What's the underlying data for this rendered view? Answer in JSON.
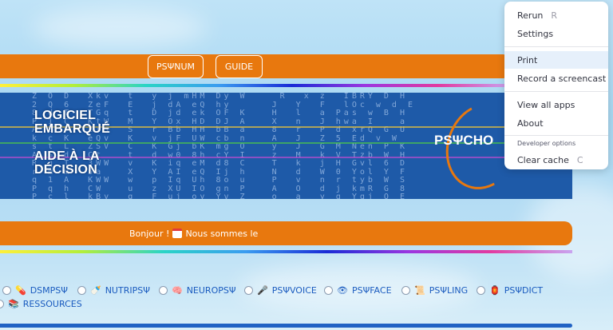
{
  "nav": {
    "buttons": [
      "PSΨNUM",
      "GUIDE"
    ]
  },
  "banner": {
    "line1": "LOGICIEL",
    "line2": "EMBARQUÉ",
    "line3": "AIDE À LA",
    "line4": "DÉCISION",
    "brand": "PSΨCHO"
  },
  "greeting": {
    "text": "Bonjour !",
    "suffix": "Nous sommes le"
  },
  "modules": [
    {
      "label": "DSMPSΨ",
      "icon": "pills-icon"
    },
    {
      "label": "NUTRIPSΨ",
      "icon": "bottle-icon"
    },
    {
      "label": "NEUROPSΨ",
      "icon": "brain-icon"
    },
    {
      "label": "PSΨVOICE",
      "icon": "microphone-icon"
    },
    {
      "label": "PSΨFACE",
      "icon": "eye-icon"
    },
    {
      "label": "PSΨLING",
      "icon": "scroll-icon"
    },
    {
      "label": "PSΨDICT",
      "icon": "lamp-icon"
    },
    {
      "label": "RESSOURCES",
      "icon": "books-icon"
    }
  ],
  "menu": {
    "rerun": "Rerun",
    "rerun_key": "R",
    "settings": "Settings",
    "print": "Print",
    "record": "Record a screencast",
    "view_apps": "View all apps",
    "about": "About",
    "dev_header": "Developer options",
    "clear_cache": "Clear cache",
    "clear_cache_key": "C"
  },
  "colors": {
    "accent": "#e8780e",
    "banner": "#1e5aa8",
    "link": "#1a5bbf"
  }
}
